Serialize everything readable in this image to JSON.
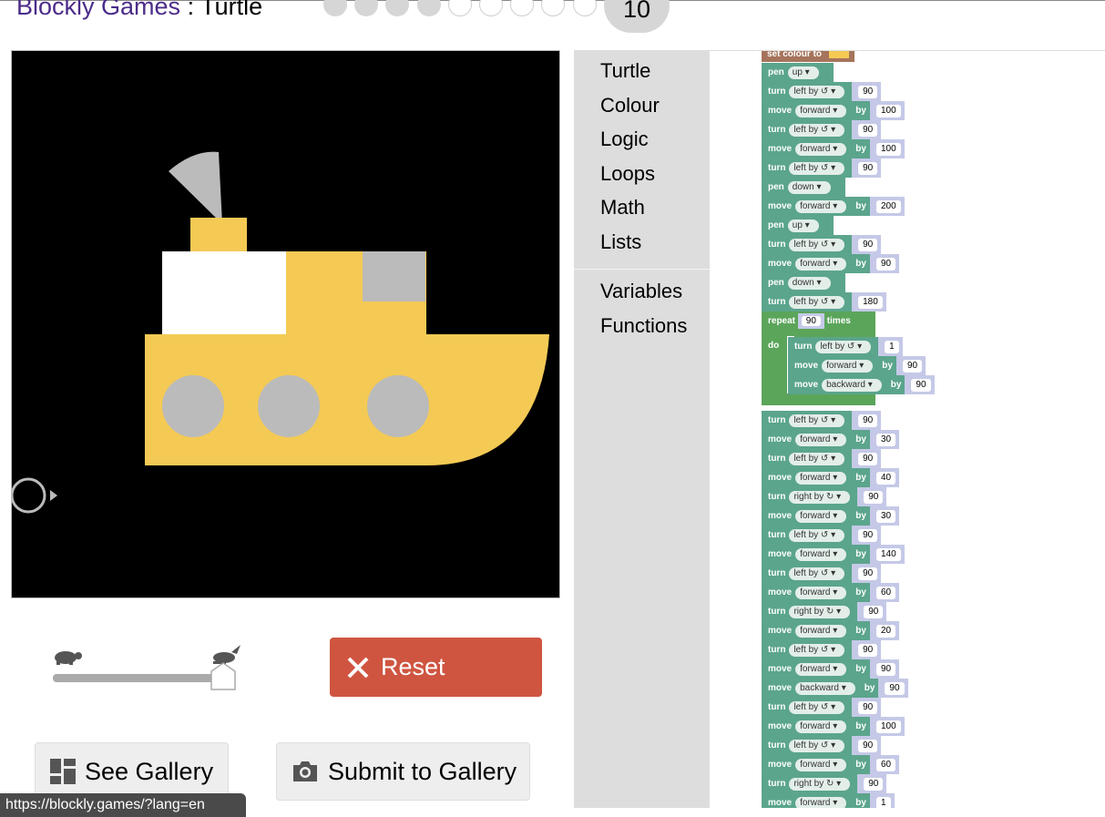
{
  "header": {
    "brand": "Blockly Games",
    "sep": " : ",
    "game": "Turtle",
    "level": "10",
    "dots_done": 4,
    "dots_total": 9
  },
  "controls": {
    "reset_label": "Reset",
    "see_gallery_label": "See Gallery",
    "submit_gallery_label": "Submit to Gallery",
    "speed_level": 0.9
  },
  "toolbox": {
    "categories": [
      "Turtle",
      "Colour",
      "Logic",
      "Loops",
      "Math",
      "Lists"
    ],
    "categories2": [
      "Variables",
      "Functions"
    ]
  },
  "workspace": {
    "top_block": "set colour to",
    "blocks": [
      {
        "k": "pen",
        "a": "up"
      },
      {
        "k": "turn",
        "a": "left by ↺",
        "v": "90"
      },
      {
        "k": "move",
        "a": "forward",
        "v": "100"
      },
      {
        "k": "turn",
        "a": "left by ↺",
        "v": "90"
      },
      {
        "k": "move",
        "a": "forward",
        "v": "100"
      },
      {
        "k": "turn",
        "a": "left by ↺",
        "v": "90"
      },
      {
        "k": "pen",
        "a": "down"
      },
      {
        "k": "move",
        "a": "forward",
        "v": "200"
      },
      {
        "k": "pen",
        "a": "up"
      },
      {
        "k": "turn",
        "a": "left by ↺",
        "v": "90"
      },
      {
        "k": "move",
        "a": "forward",
        "v": "90"
      },
      {
        "k": "pen",
        "a": "down"
      },
      {
        "k": "turn",
        "a": "left by ↺",
        "v": "180"
      }
    ],
    "repeat": {
      "label": "repeat",
      "count": "90",
      "times": "times",
      "do": "do",
      "inner": [
        {
          "k": "turn",
          "a": "left by ↺",
          "v": "1"
        },
        {
          "k": "move",
          "a": "forward",
          "v": "90"
        },
        {
          "k": "move",
          "a": "backward",
          "v": "90"
        }
      ]
    },
    "blocks_after": [
      {
        "k": "turn",
        "a": "left by ↺",
        "v": "90"
      },
      {
        "k": "move",
        "a": "forward",
        "v": "30"
      },
      {
        "k": "turn",
        "a": "left by ↺",
        "v": "90"
      },
      {
        "k": "move",
        "a": "forward",
        "v": "40"
      },
      {
        "k": "turn",
        "a": "right by ↻",
        "v": "90"
      },
      {
        "k": "move",
        "a": "forward",
        "v": "30"
      },
      {
        "k": "turn",
        "a": "left by ↺",
        "v": "90"
      },
      {
        "k": "move",
        "a": "forward",
        "v": "140"
      },
      {
        "k": "turn",
        "a": "left by ↺",
        "v": "90"
      },
      {
        "k": "move",
        "a": "forward",
        "v": "60"
      },
      {
        "k": "turn",
        "a": "right by ↻",
        "v": "90"
      },
      {
        "k": "move",
        "a": "forward",
        "v": "20"
      },
      {
        "k": "turn",
        "a": "left by ↺",
        "v": "90"
      },
      {
        "k": "move",
        "a": "forward",
        "v": "90"
      },
      {
        "k": "move",
        "a": "backward",
        "v": "90"
      },
      {
        "k": "turn",
        "a": "left by ↺",
        "v": "90"
      },
      {
        "k": "move",
        "a": "forward",
        "v": "100"
      },
      {
        "k": "turn",
        "a": "left by ↺",
        "v": "90"
      },
      {
        "k": "move",
        "a": "forward",
        "v": "60"
      },
      {
        "k": "turn",
        "a": "right by ↻",
        "v": "90"
      },
      {
        "k": "move",
        "a": "forward",
        "v": "1"
      }
    ],
    "by_label": "by"
  },
  "status_url": "https://blockly.games/?lang=en",
  "colors": {
    "reset": "#cf5540",
    "brand": "#4b2c8a",
    "ship": "#f4ca55",
    "grey": "#bbbbbb",
    "block": "#5ba58c",
    "loop": "#5ba55b"
  }
}
